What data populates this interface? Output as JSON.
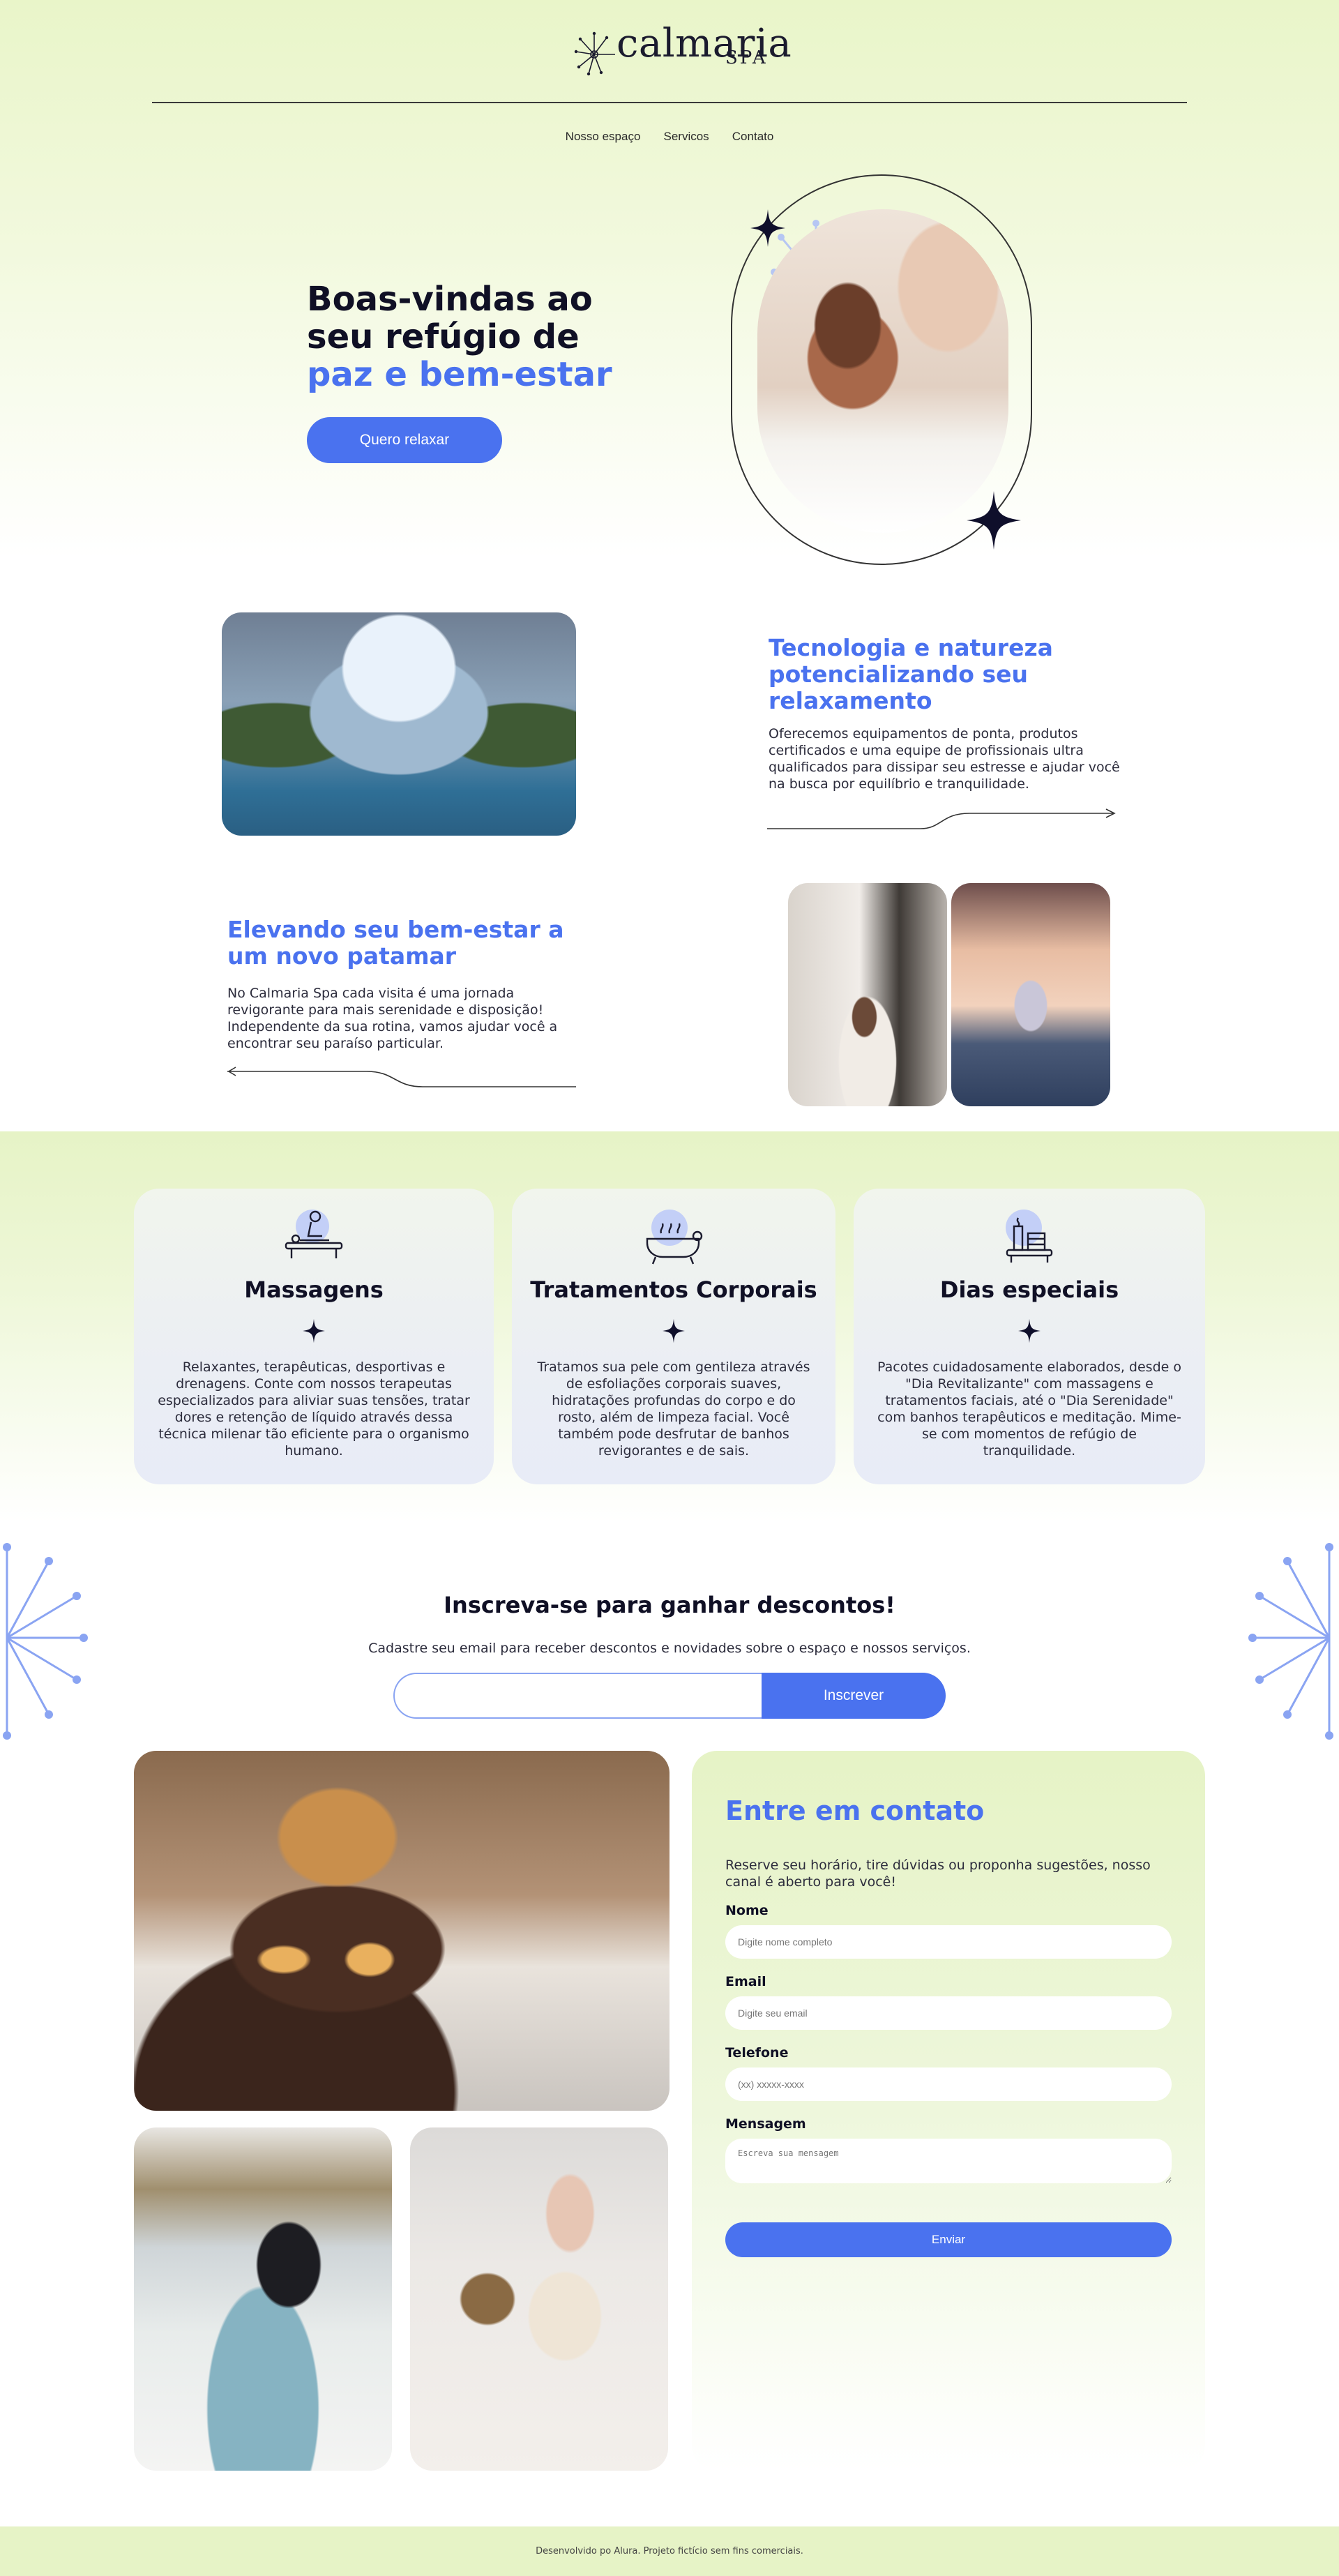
{
  "brand": {
    "name": "calmaria",
    "tagline": "SPA"
  },
  "nav": {
    "items": [
      "Nosso espaço",
      "Servicos",
      "Contato"
    ]
  },
  "hero": {
    "title_line1": "Boas-vindas ao",
    "title_line2": "seu refúgio de",
    "title_accent": "paz e bem-estar",
    "cta": "Quero relaxar"
  },
  "features": [
    {
      "title": "Tecnologia e natureza potencializando seu relaxamento",
      "text": "Oferecemos equipamentos de ponta, produtos certificados e uma equipe de profissionais ultra qualificados para dissipar seu estresse e ajudar você na busca por equilíbrio e tranquilidade."
    },
    {
      "title": "Elevando seu bem-estar a um novo patamar",
      "text": "No Calmaria Spa cada visita é uma jornada revigorante para mais serenidade e disposição! Independente da sua rotina, vamos ajudar você a encontrar seu paraíso particular."
    }
  ],
  "services": [
    {
      "title": "Massagens",
      "icon": "massage-icon",
      "text": "Relaxantes, terapêuticas, desportivas e drenagens. Conte com nossos terapeutas especializados para aliviar suas tensões, tratar dores e retenção de líquido através dessa técnica milenar tão eficiente para o organismo humano."
    },
    {
      "title": "Tratamentos Corporais",
      "icon": "bathtub-icon",
      "text": "Tratamos sua pele com gentileza através de esfoliações corporais suaves, hidratações profundas do corpo e do rosto, além de limpeza facial. Você também pode desfrutar de banhos revigorantes e de sais."
    },
    {
      "title": "Dias especiais",
      "icon": "candles-icon",
      "text": "Pacotes cuidadosamente elaborados, desde o \"Dia Revitalizante\" com massagens e tratamentos faciais, até o \"Dia Serenidade\" com banhos terapêuticos e meditação. Mime-se com momentos de refúgio de tranquilidade."
    }
  ],
  "newsletter": {
    "title": "Inscreva-se para ganhar descontos!",
    "subtitle": "Cadastre seu email para receber descontos e novidades sobre o espaço e nossos serviços.",
    "input_placeholder": "",
    "button": "Inscrever"
  },
  "contact": {
    "title": "Entre em contato",
    "description": "Reserve seu horário, tire dúvidas ou proponha sugestões, nosso canal é aberto para você!",
    "fields": {
      "name_label": "Nome",
      "name_placeholder": "Digite nome completo",
      "email_label": "Email",
      "email_placeholder": "Digite seu email",
      "phone_label": "Telefone",
      "phone_placeholder": "(xx) xxxxx-xxxx",
      "message_label": "Mensagem",
      "message_placeholder": "Escreva sua mensagem"
    },
    "submit": "Enviar"
  },
  "footer": {
    "text": "Desenvolvido po Alura. Projeto fictício sem fins comerciais."
  },
  "colors": {
    "accent": "#4a72ef",
    "band": "#e6f3c6",
    "ink": "#101025"
  }
}
